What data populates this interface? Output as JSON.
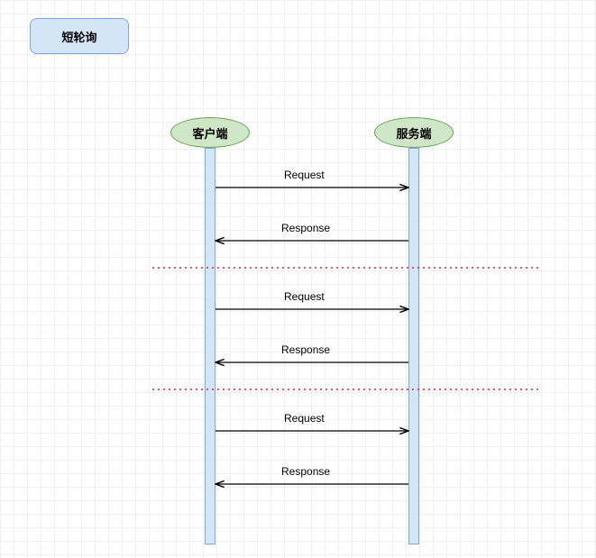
{
  "title": "短轮询",
  "actors": {
    "client": "客户端",
    "server": "服务端"
  },
  "messages": {
    "m1": "Request",
    "m2": "Response",
    "m3": "Request",
    "m4": "Response",
    "m5": "Request",
    "m6": "Response"
  },
  "chart_data": {
    "type": "sequence-diagram",
    "title": "短轮询",
    "participants": [
      "客户端",
      "服务端"
    ],
    "interactions": [
      {
        "from": "客户端",
        "to": "服务端",
        "label": "Request"
      },
      {
        "from": "服务端",
        "to": "客户端",
        "label": "Response"
      },
      {
        "separator": true
      },
      {
        "from": "客户端",
        "to": "服务端",
        "label": "Request"
      },
      {
        "from": "服务端",
        "to": "客户端",
        "label": "Response"
      },
      {
        "separator": true
      },
      {
        "from": "客户端",
        "to": "服务端",
        "label": "Request"
      },
      {
        "from": "服务端",
        "to": "客户端",
        "label": "Response"
      }
    ]
  }
}
